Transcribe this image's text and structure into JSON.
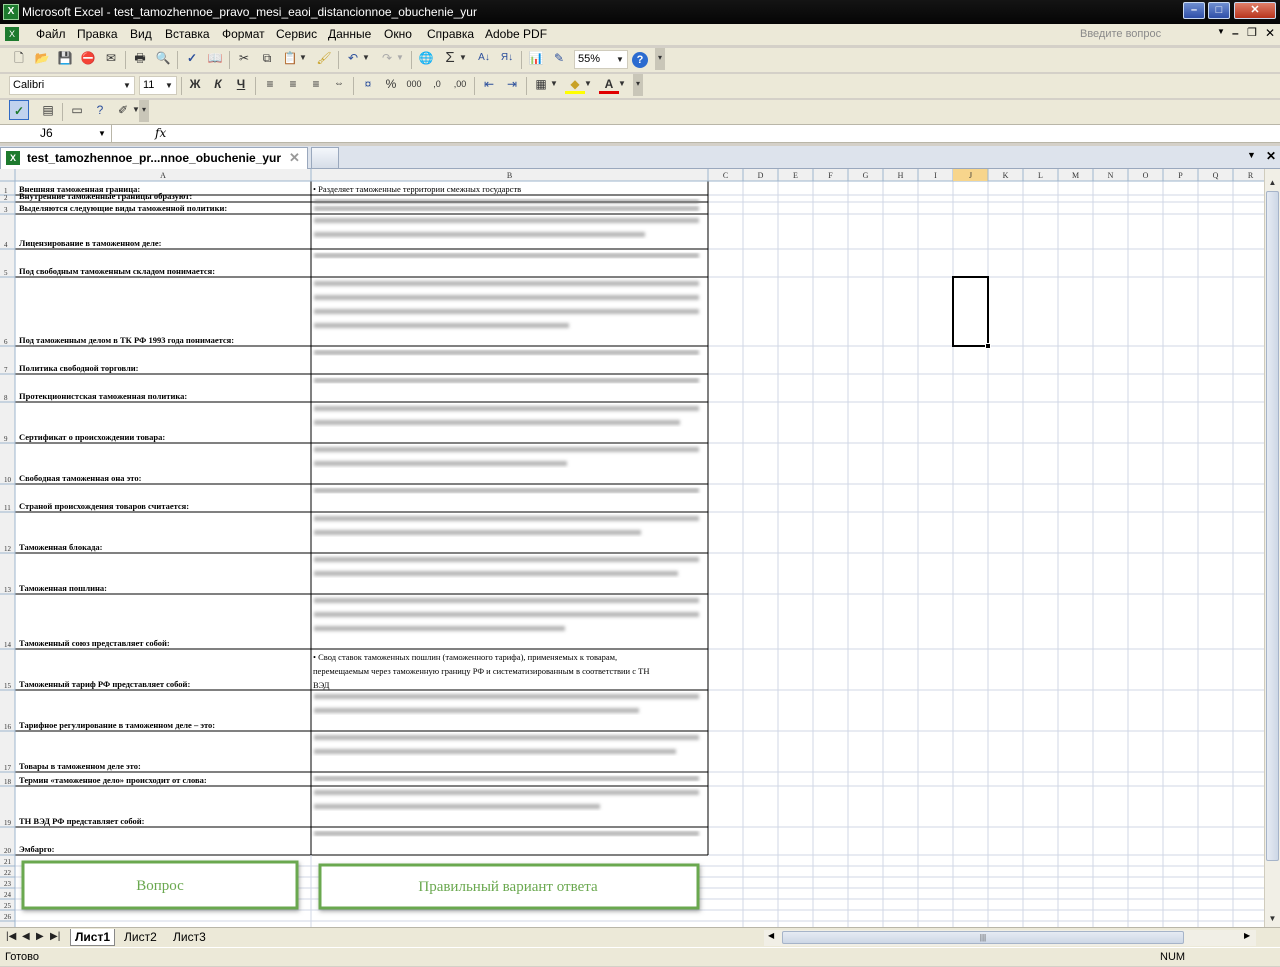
{
  "window": {
    "title": "Microsoft Excel - test_tamozhennoe_pravo_mesi_eaoi_distancionnoe_obuchenie_yur"
  },
  "menu": {
    "items": [
      "Файл",
      "Правка",
      "Вид",
      "Вставка",
      "Формат",
      "Сервис",
      "Данные",
      "Окно",
      "Справка",
      "Adobe PDF"
    ],
    "ask_placeholder": "Введите вопрос"
  },
  "toolbar": {
    "zoom": "55%",
    "font": "Calibri",
    "font_size": "11"
  },
  "formula_bar": {
    "name_box": "J6",
    "fx": "fx",
    "value": ""
  },
  "workbook_tab": {
    "name": "test_tamozhennoe_pr...nnoe_obuchenie_yur"
  },
  "columns": [
    "A",
    "B",
    "C",
    "D",
    "E",
    "F",
    "G",
    "H",
    "I",
    "J",
    "K",
    "L",
    "M",
    "N",
    "O",
    "P",
    "Q",
    "R"
  ],
  "rows": [
    {
      "n": "1",
      "q": "Внешняя таможенная граница:",
      "a": "•  Разделяет таможенные территории смежных государств",
      "blur": false
    },
    {
      "n": "2",
      "q": "Внутренние таможенные границы образуют:",
      "a": "",
      "blur": true
    },
    {
      "n": "3",
      "q": "Выделяются следующие виды таможенной политики:",
      "a": "",
      "blur": true
    },
    {
      "n": "4",
      "q": "Лицензирование в таможенном деле:",
      "a": "",
      "blur": true
    },
    {
      "n": "5",
      "q": "Под свободным таможенным складом понимается:",
      "a": "",
      "blur": true
    },
    {
      "n": "6",
      "q": "Под таможенным делом в ТК РФ 1993 года понимается:",
      "a": "",
      "blur": true
    },
    {
      "n": "7",
      "q": "Политика свободной торговли:",
      "a": "",
      "blur": true
    },
    {
      "n": "8",
      "q": "Протекционистская таможенная политика:",
      "a": "",
      "blur": true
    },
    {
      "n": "9",
      "q": "Сертификат о происхождении товара:",
      "a": "",
      "blur": true
    },
    {
      "n": "10",
      "q": "Свободная таможенная она это:",
      "a": "",
      "blur": true
    },
    {
      "n": "11",
      "q": "Страной происхождения товаров считается:",
      "a": "",
      "blur": true
    },
    {
      "n": "12",
      "q": "Таможенная блокада:",
      "a": "",
      "blur": true
    },
    {
      "n": "13",
      "q": "Таможенная пошлина:",
      "a": "",
      "blur": true
    },
    {
      "n": "14",
      "q": "Таможенный союз представляет собой:",
      "a": "",
      "blur": true
    },
    {
      "n": "15",
      "q": "Таможенный тариф РФ представляет собой:",
      "a": [
        "•  Свод ставок таможенных пошлин (таможенного тарифа), применяемых к товарам,",
        "перемещаемым через таможенную границу РФ и систематизированным в соответствии с ТН",
        "ВЭД"
      ],
      "blur": false
    },
    {
      "n": "16",
      "q": "Тарифное регулирование в  таможенном деле – это:",
      "a": "",
      "blur": true
    },
    {
      "n": "17",
      "q": "Товары в таможенном деле это:",
      "a": "",
      "blur": true
    },
    {
      "n": "18",
      "q": "Термин «таможенное дело» происходит от слова:",
      "a": "",
      "blur": true
    },
    {
      "n": "19",
      "q": "ТН ВЭД РФ представляет собой:",
      "a": "",
      "blur": true
    },
    {
      "n": "20",
      "q": "Эмбарго:",
      "a": "",
      "blur": true
    },
    {
      "n": "21",
      "q": "",
      "a": "",
      "blur": false
    },
    {
      "n": "22",
      "q": "",
      "a": "",
      "blur": false
    },
    {
      "n": "23",
      "q": "",
      "a": "",
      "blur": false
    },
    {
      "n": "24",
      "q": "",
      "a": "",
      "blur": false
    },
    {
      "n": "25",
      "q": "",
      "a": "",
      "blur": false
    },
    {
      "n": "26",
      "q": "",
      "a": "",
      "blur": false
    }
  ],
  "shapes": {
    "question_box": "Вопрос",
    "answer_box": "Правильный вариант ответа",
    "accent": "#6aa84f"
  },
  "sheets": [
    "Лист1",
    "Лист2",
    "Лист3"
  ],
  "status": {
    "left": "Готово",
    "right": "NUM"
  },
  "colors": {
    "title_bg": "#0a0a0a",
    "menu_bg": "#ece9d8",
    "grid_line": "#d0d7e5",
    "header_bg": "#f0f0f0",
    "selected_col": "#f7d58c"
  }
}
